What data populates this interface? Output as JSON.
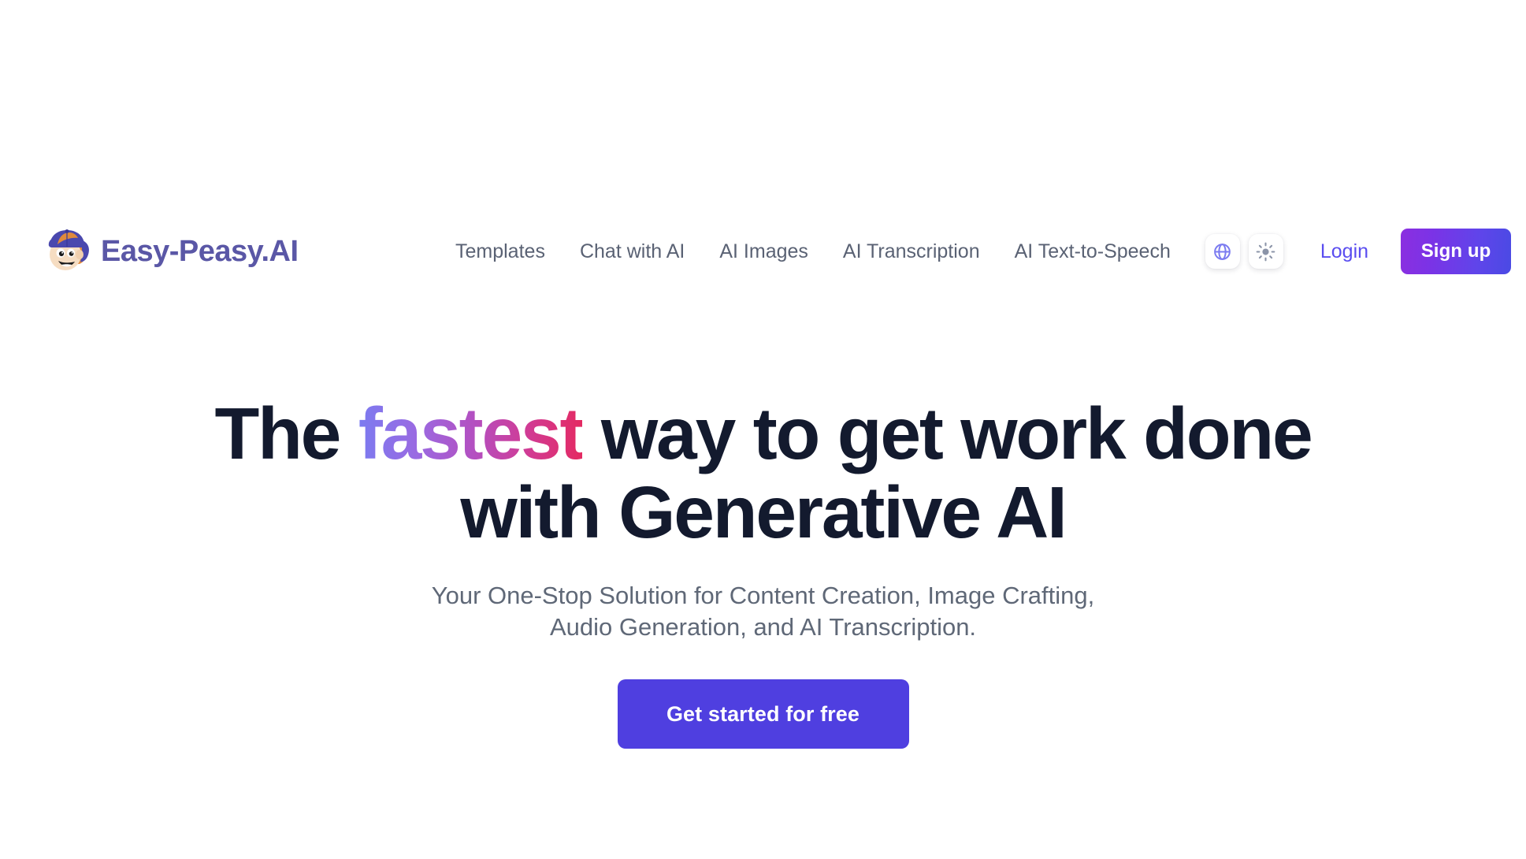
{
  "brand": {
    "name": "Easy-Peasy.AI",
    "logo_icon": "boy-with-cap-avatar-icon",
    "text_color": "#5a57a6"
  },
  "header": {
    "nav_items": [
      {
        "label": "Templates"
      },
      {
        "label": "Chat with AI"
      },
      {
        "label": "AI Images"
      },
      {
        "label": "AI Transcription"
      },
      {
        "label": "AI Text-to-Speech"
      }
    ],
    "icon_buttons": [
      {
        "name": "globe-icon",
        "title": "Language",
        "color": "#7b7bf0"
      },
      {
        "name": "sun-icon",
        "title": "Theme",
        "color": "#8b94a8"
      }
    ],
    "login_label": "Login",
    "login_color": "#5a4df0",
    "signup_label": "Sign up",
    "signup_gradient_from": "#8b2fe0",
    "signup_gradient_to": "#4a4ae4"
  },
  "hero": {
    "title_part1": "The ",
    "title_accent": "fastest",
    "title_part2": " way to get work done with Generative AI",
    "accent_gradient_from": "#7b7bf0",
    "accent_gradient_to": "#e42a62",
    "title_color": "#131a2e",
    "subtitle": "Your One-Stop Solution for Content Creation, Image Crafting, Audio Generation, and AI Transcription.",
    "subtitle_color": "#5f6877",
    "cta_label": "Get started for free",
    "cta_color": "#4f3fe0"
  }
}
